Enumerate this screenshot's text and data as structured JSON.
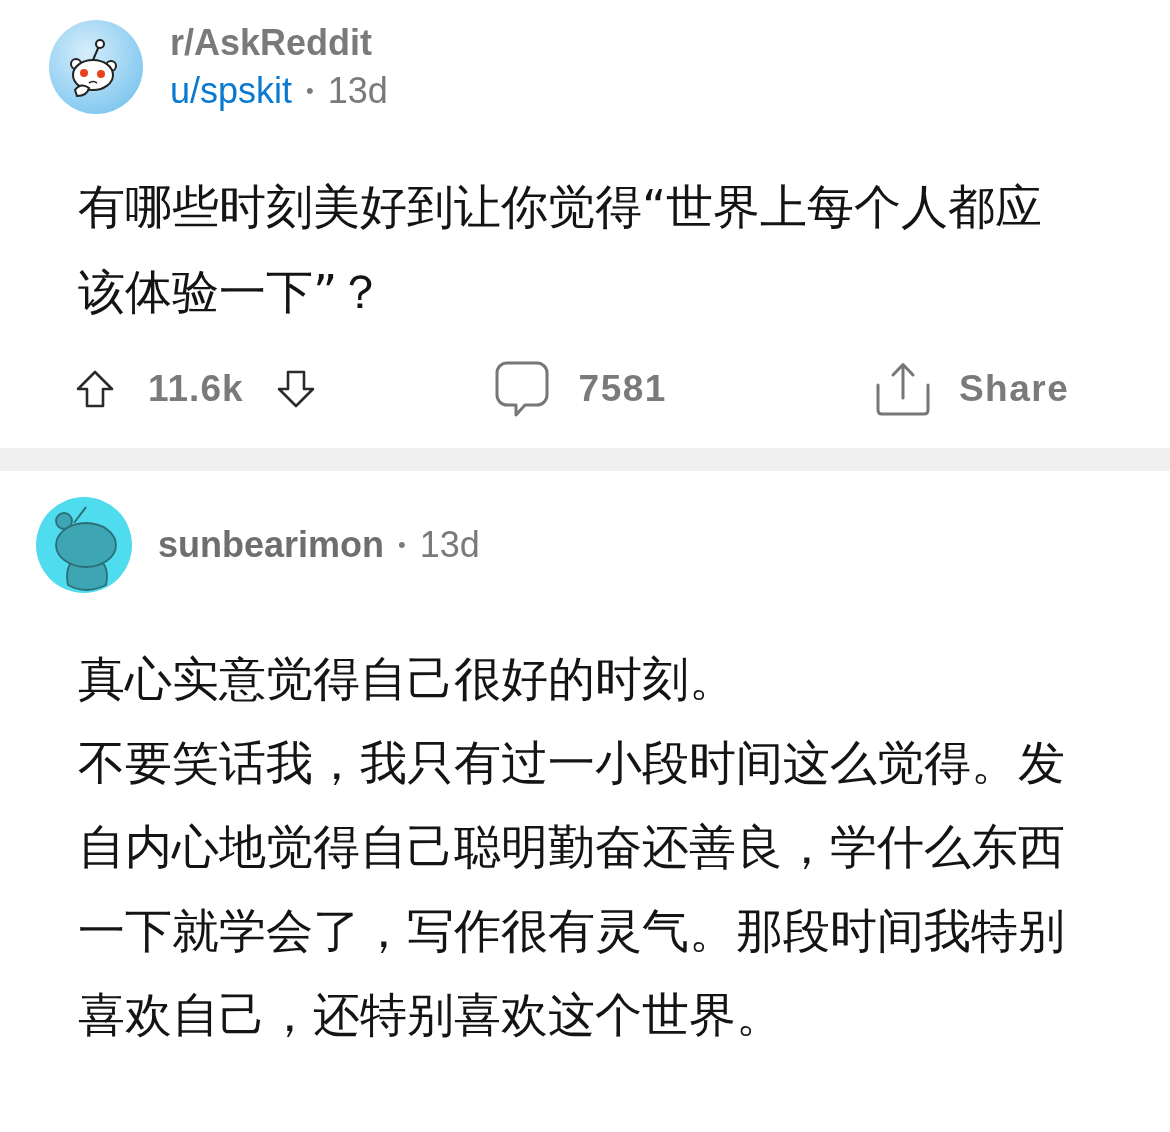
{
  "post": {
    "subreddit": "r/AskReddit",
    "author": "u/spskit",
    "separator": "•",
    "age": "13d",
    "title": "有哪些时刻美好到让你觉得“世界上每个人都应该体验一下”？",
    "votes": "11.6k",
    "comments": "7581",
    "share": "Share"
  },
  "comment": {
    "author": "sunbearimon",
    "separator": "•",
    "age": "13d",
    "paragraphs": [
      "真心实意觉得自己很好的时刻。",
      "不要笑话我，我只有过一小段时间这么觉得。发自内心地觉得自己聪明勤奋还善良，学什么东西一下就学会了，写作很有灵气。那段时间我特别喜欢自己，还特别喜欢这个世界。"
    ]
  }
}
